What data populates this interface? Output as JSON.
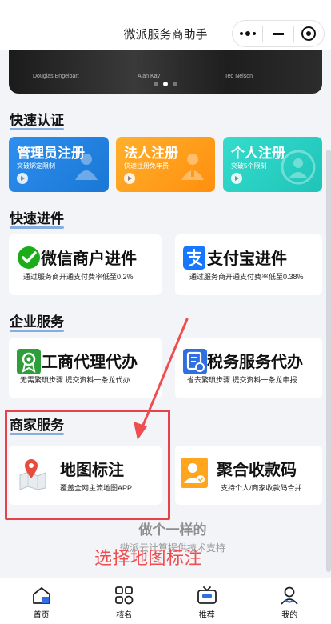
{
  "app": {
    "title": "微派服务商助手"
  },
  "banner": {
    "captions": [
      "Douglas Engelbart",
      "Alan Kay",
      "Ted Nelson"
    ],
    "active_dot": 1
  },
  "sections": {
    "quick_cert": "快速认证",
    "quick_onboard": "快速进件",
    "enterprise": "企业服务",
    "merchant": "商家服务"
  },
  "quick_cards": [
    {
      "title": "管理员注册",
      "subtitle": "突破绑定限制",
      "color": "#1f8fe8"
    },
    {
      "title": "法人注册",
      "subtitle": "快速注册免年费",
      "color": "#ff9f1a"
    },
    {
      "title": "个人注册",
      "subtitle": "突破5个限制",
      "color": "#2ad1c5"
    }
  ],
  "onboard_cards": [
    {
      "title": "微信商户进件",
      "subtitle": "通过服务商开通支付费率低至0.2%",
      "icon": "wechat-pay-icon"
    },
    {
      "title": "支付宝进件",
      "subtitle": "通过服务商开通支付费率低至0.38%",
      "icon": "alipay-icon"
    }
  ],
  "enterprise_cards": [
    {
      "title": "工商代理代办",
      "subtitle": "无需繁琐步骤 提交资料一条龙代办",
      "icon": "license-badge-icon"
    },
    {
      "title": "税务服务代办",
      "subtitle": "省去繁琐步骤 提交资料一条龙申报",
      "icon": "tax-document-icon"
    }
  ],
  "merchant_cards": [
    {
      "title": "地图标注",
      "subtitle": "覆盖全网主流地图APP",
      "icon": "map-pin-icon"
    },
    {
      "title": "聚合收款码",
      "subtitle": "支持个人/商家收款码合并",
      "icon": "payment-code-icon"
    }
  ],
  "watermark": {
    "line1": "做个一样的",
    "line2": "微派云计算提供技术支持"
  },
  "annotation": {
    "text": "选择地图标注",
    "color": "#ee4e50"
  },
  "tabs": [
    {
      "label": "首页",
      "icon": "home-icon"
    },
    {
      "label": "核名",
      "icon": "grid-icon"
    },
    {
      "label": "推荐",
      "icon": "tv-icon"
    },
    {
      "label": "我的",
      "icon": "user-icon"
    }
  ]
}
